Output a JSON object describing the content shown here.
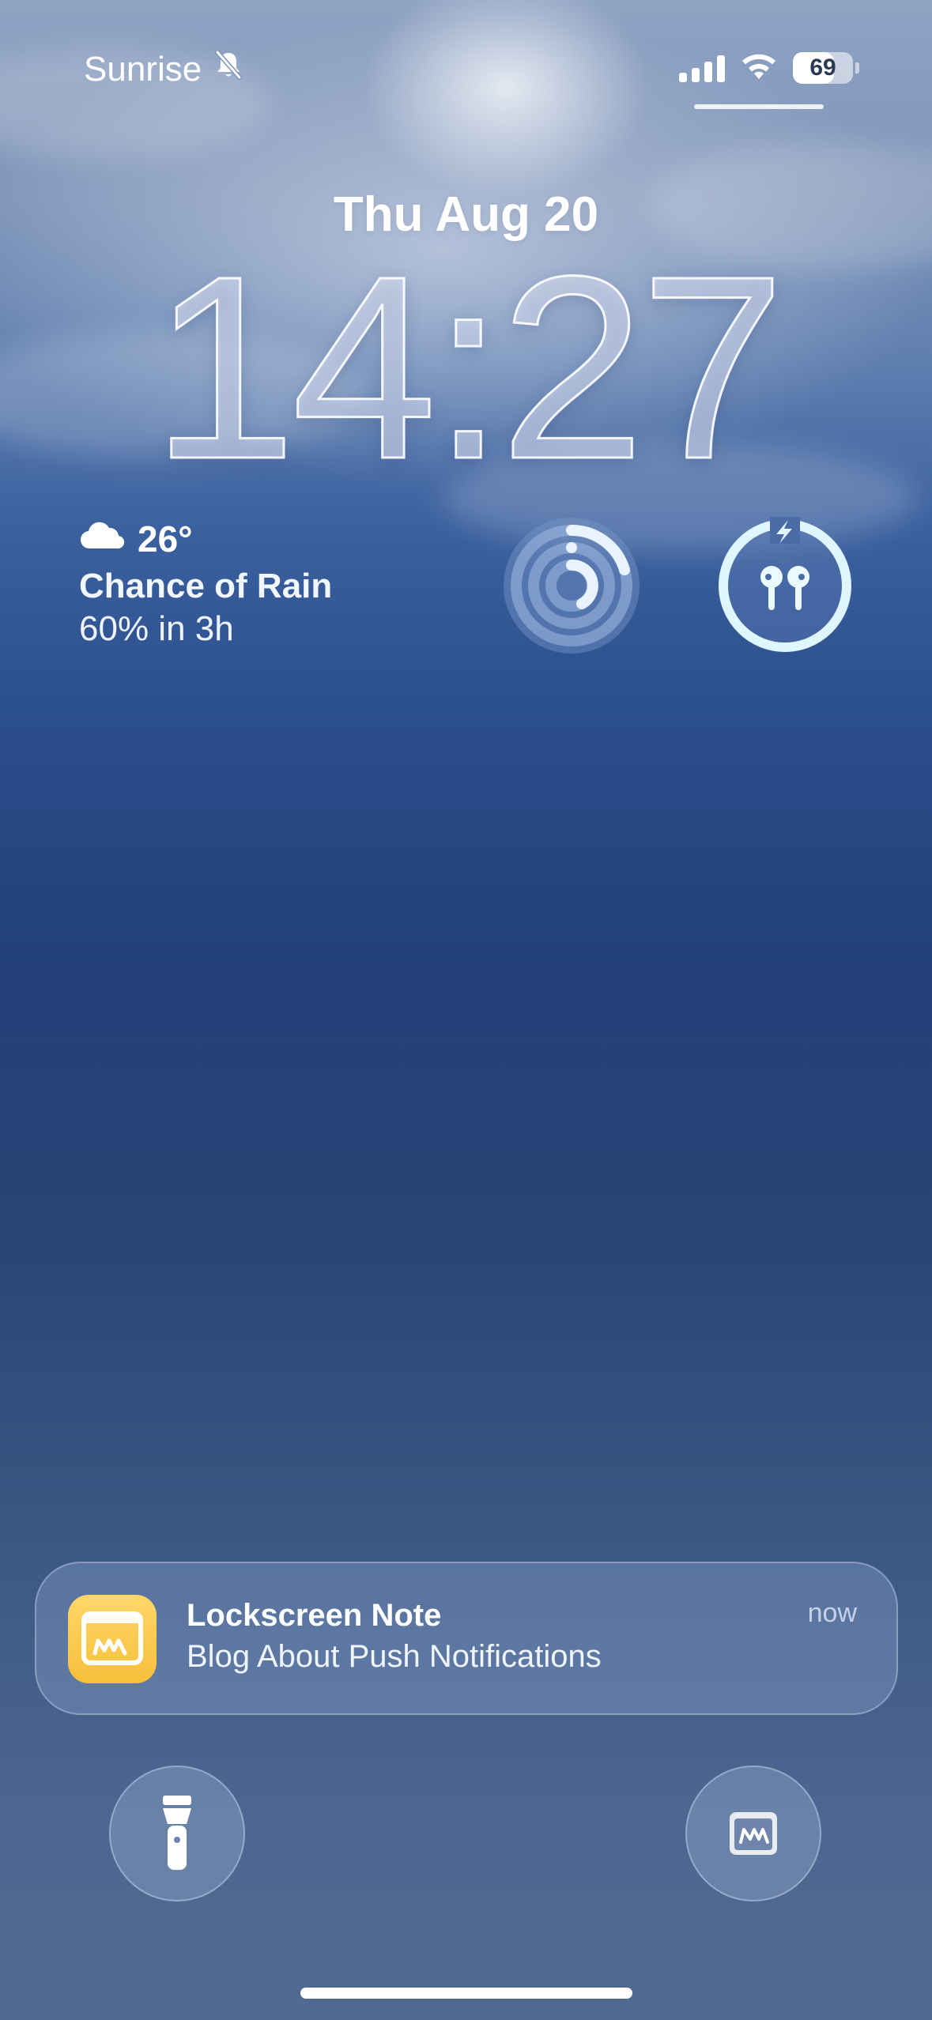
{
  "status_bar": {
    "carrier_label": "Sunrise",
    "silent_icon": "bell-slash-icon",
    "signal_icon": "cellular-signal-icon",
    "wifi_icon": "wifi-icon",
    "battery_level": "69"
  },
  "lockscreen": {
    "date": "Thu Aug 20",
    "time": "14:27"
  },
  "weather": {
    "icon": "cloud-icon",
    "temperature": "26°",
    "condition": "Chance of Rain",
    "detail": "60% in 3h"
  },
  "widgets": {
    "activity_icon": "activity-rings-icon",
    "airpods_icon": "airpods-charging-icon"
  },
  "notification": {
    "app_icon": "lockscreen-note-app-icon",
    "title": "Lockscreen Note",
    "body": "Blog About Push Notifications",
    "time": "now"
  },
  "quick_actions": {
    "left_icon": "flashlight-icon",
    "right_icon": "lockscreen-note-icon"
  },
  "colors": {
    "notif_app_icon": "#f6bf3a",
    "ring_accent": "#dff6ff"
  }
}
